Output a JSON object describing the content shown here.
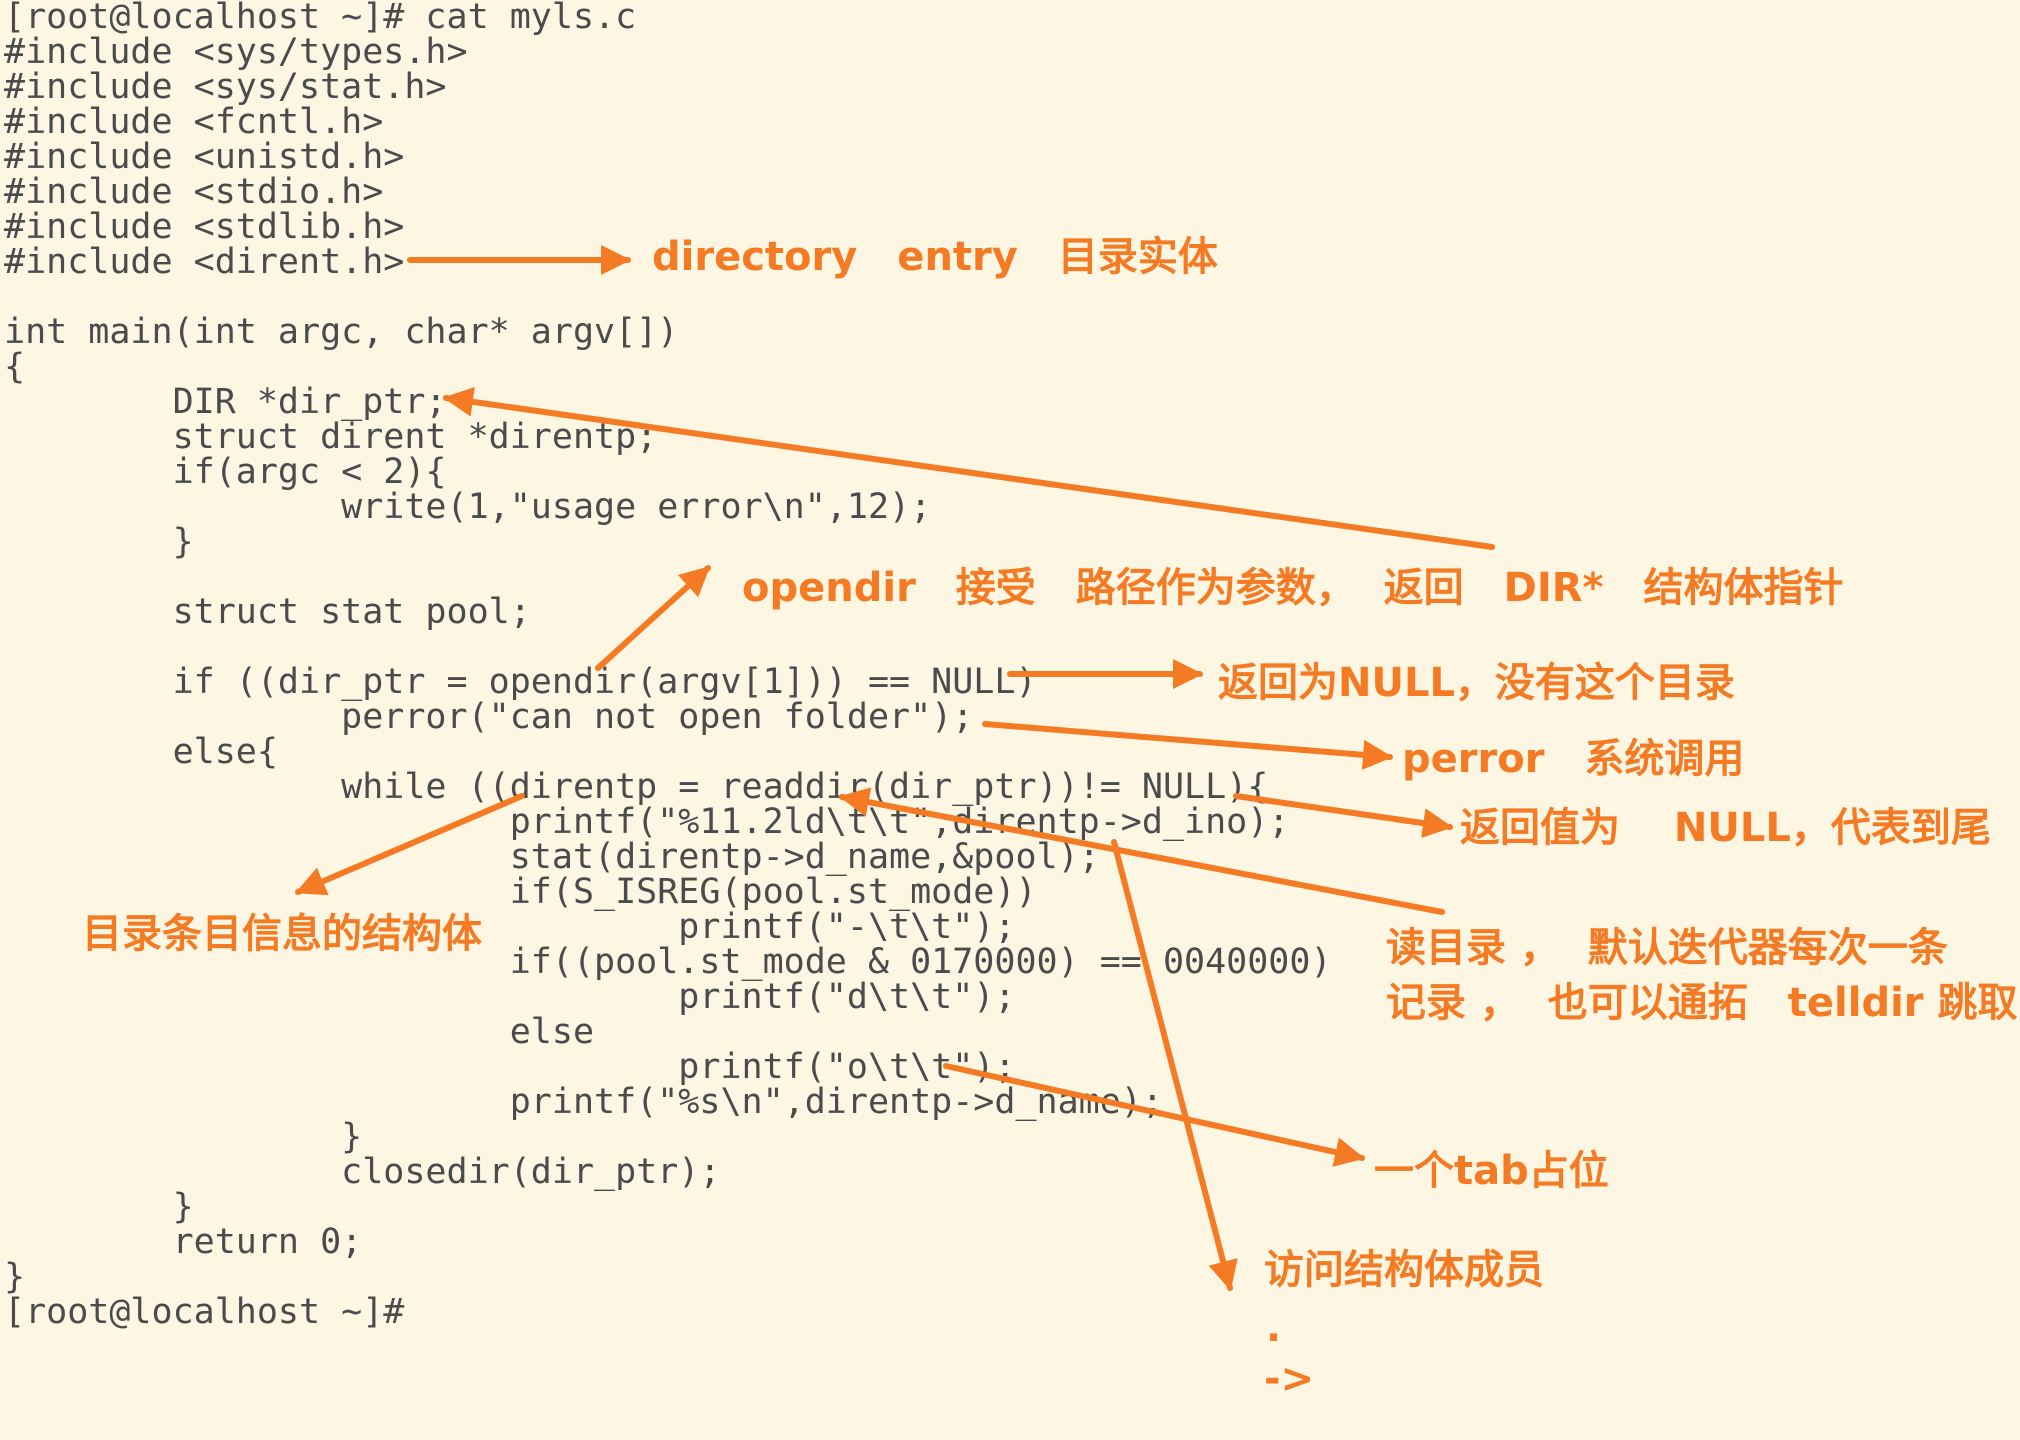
{
  "terminal": {
    "lines": [
      "[root@localhost ~]# cat myls.c",
      "#include <sys/types.h>",
      "#include <sys/stat.h>",
      "#include <fcntl.h>",
      "#include <unistd.h>",
      "#include <stdio.h>",
      "#include <stdlib.h>",
      "#include <dirent.h>",
      "",
      "int main(int argc, char* argv[])",
      "{",
      "        DIR *dir_ptr;",
      "        struct dirent *direntp;",
      "        if(argc < 2){",
      "                write(1,\"usage error\\n\",12);",
      "        }",
      "",
      "        struct stat pool;",
      "",
      "        if ((dir_ptr = opendir(argv[1])) == NULL)",
      "                perror(\"can not open folder\");",
      "        else{",
      "                while ((direntp = readdir(dir_ptr))!= NULL){",
      "                        printf(\"%11.2ld\\t\\t\",direntp->d_ino);",
      "                        stat(direntp->d_name,&pool);",
      "                        if(S_ISREG(pool.st_mode))",
      "                                printf(\"-\\t\\t\");",
      "                        if((pool.st_mode & 0170000) == 0040000)",
      "                                printf(\"d\\t\\t\");",
      "                        else",
      "                                printf(\"o\\t\\t\");",
      "                        printf(\"%s\\n\",direntp->d_name);",
      "                }",
      "                closedir(dir_ptr);",
      "        }",
      "        return 0;",
      "}",
      "[root@localhost ~]#"
    ]
  },
  "annotations": {
    "directory_entry": "directory　entry　目录实体",
    "opendir": "opendir　接受　路径作为参数，  返回　DIR*　结构体指针",
    "return_null": "返回为NULL，没有这个目录",
    "perror": "perror　系统调用",
    "readdir_null": "返回值为　 NULL，代表到尾",
    "dirent_struct": "目录条目信息的结构体",
    "readdir_line1": "读目录 ，  默认迭代器每次一条",
    "readdir_line2": "记录 ，  也可以通拓　telldir 跳取",
    "tab": "一个tab占位",
    "member_access": "访问结构体成员",
    "dot": ".",
    "arrow_op": "->"
  },
  "colors": {
    "background": "#fdf6e3",
    "code_text": "#4b4b4b",
    "annotation": "#f47a23"
  }
}
